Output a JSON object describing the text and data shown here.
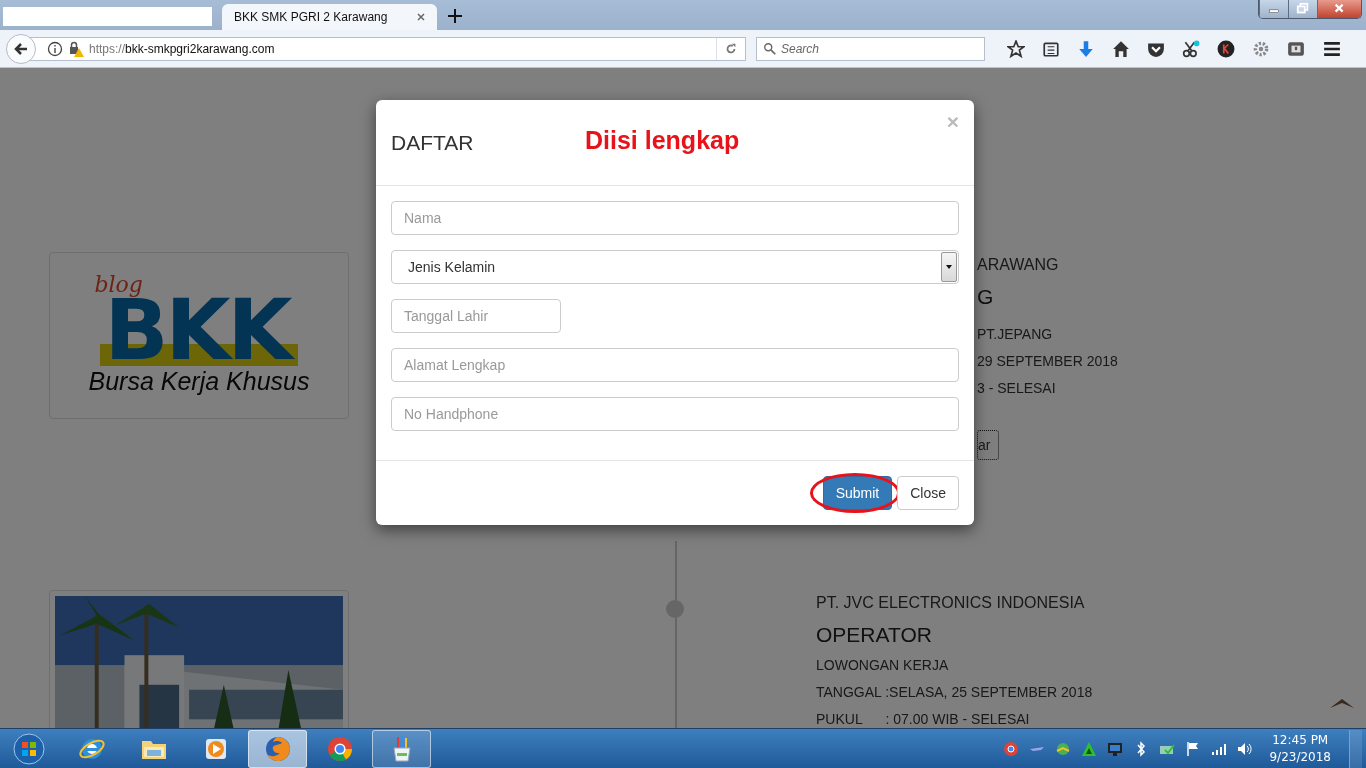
{
  "browser": {
    "tabs": [
      {
        "kind": "blank",
        "selected": false
      },
      {
        "kind": "page",
        "title": "BKK SMK PGRI 2 Karawang",
        "selected": true
      }
    ],
    "address": {
      "scheme": "https://",
      "host": "bkk-smkpgri2karawang.com"
    },
    "search": {
      "placeholder": "Search"
    }
  },
  "page": {
    "logo": {
      "script": "blog",
      "wordmark": "BKK",
      "tagline": "Bursa Kerja Khusus"
    },
    "listings": [
      {
        "company": "ARAWANG",
        "position": "G",
        "lines": [
          "PT.JEPANG",
          "29 SEPTEMBER 2018",
          "3 - SELESAI"
        ],
        "button": "ar"
      },
      {
        "company": "PT. JVC ELECTRONICS INDONESIA",
        "position": "OPERATOR",
        "lines": [
          "LOWONGAN KERJA",
          "TANGGAL :SELASA, 25 SEPTEMBER 2018",
          "PUKUL      : 07.00 WIB - SELESAI"
        ]
      }
    ]
  },
  "modal": {
    "title": "DAFTAR",
    "note": "Diisi lengkap",
    "close_symbol": "×",
    "fields": [
      {
        "kind": "text",
        "placeholder": "Nama"
      },
      {
        "kind": "select",
        "value": "Jenis Kelamin"
      },
      {
        "kind": "date",
        "placeholder": "Tanggal Lahir"
      },
      {
        "kind": "text",
        "placeholder": "Alamat Lengkap"
      },
      {
        "kind": "text",
        "placeholder": "No Handphone"
      }
    ],
    "buttons": [
      {
        "kind": "primary",
        "label": "Submit",
        "highlighted": true
      },
      {
        "kind": "default",
        "label": "Close",
        "highlighted": false
      }
    ]
  },
  "taskbar": {
    "apps": [
      {
        "kind": "ie",
        "running": false,
        "selected": false
      },
      {
        "kind": "explorer",
        "running": false,
        "selected": false
      },
      {
        "kind": "media",
        "running": false,
        "selected": false
      },
      {
        "kind": "firefox",
        "running": true,
        "selected": true
      },
      {
        "kind": "chrome",
        "running": false,
        "selected": false
      },
      {
        "kind": "paint",
        "running": true,
        "selected": false
      }
    ],
    "clock": {
      "time": "12:45 PM",
      "date": "9/23/2018"
    }
  }
}
